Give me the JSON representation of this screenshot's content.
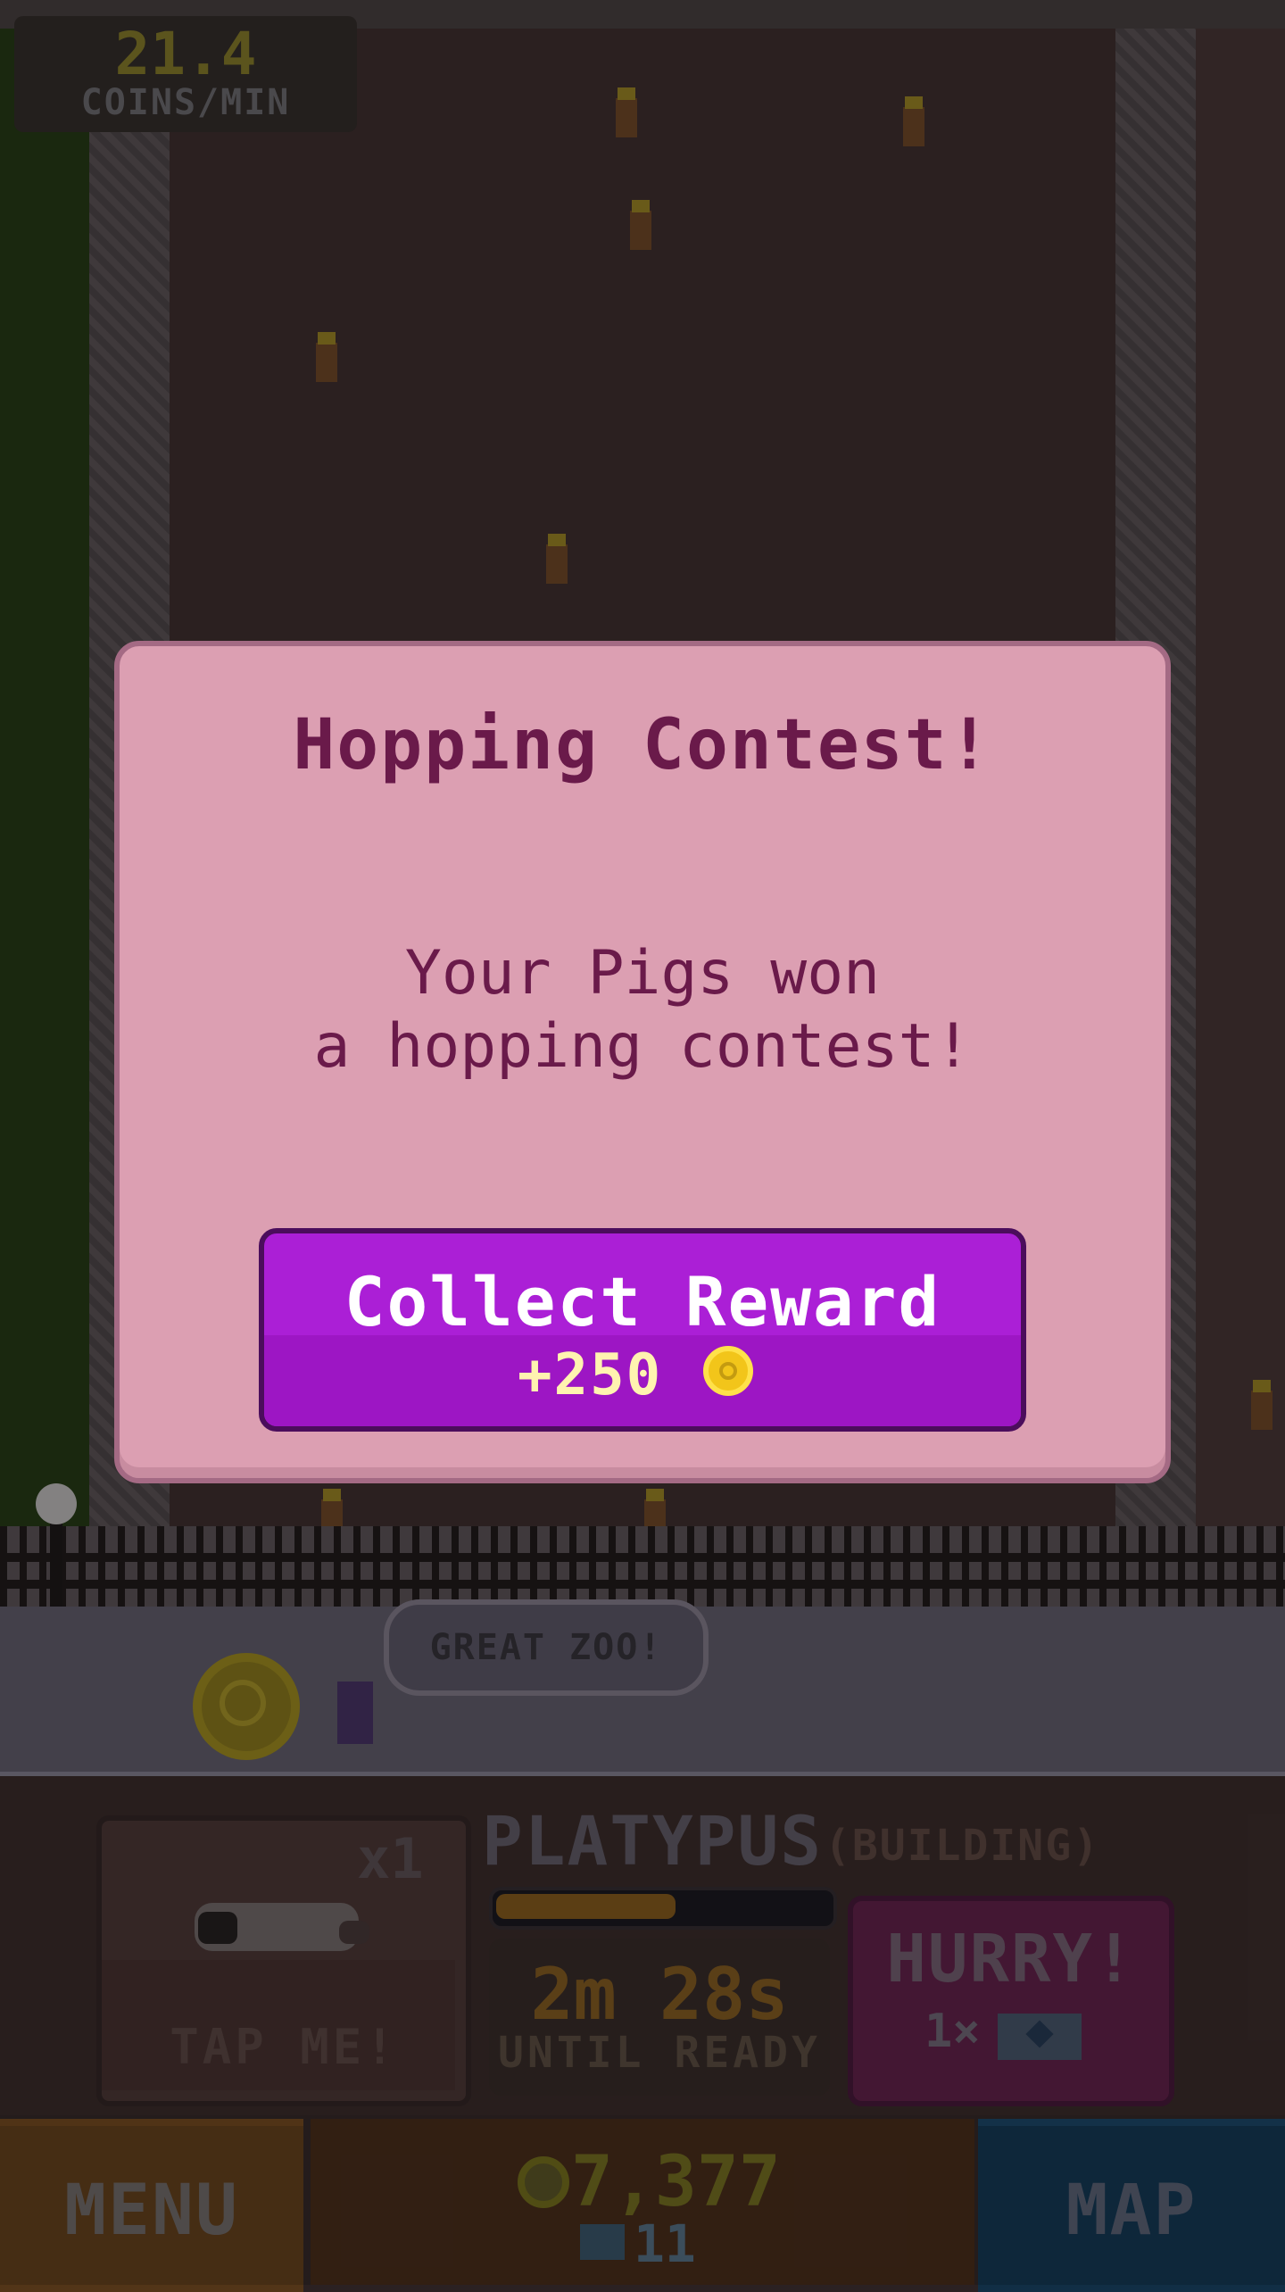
{
  "hud": {
    "coin_rate_value": "21.4",
    "coin_rate_label": "COINS/MIN"
  },
  "world": {
    "sign_text": "GREAT ZOO!"
  },
  "modal": {
    "title": "Hopping Contest!",
    "body_line1": "Your Pigs won",
    "body_line2": "a hopping contest!",
    "button_label": "Collect Reward",
    "reward_amount": "+250",
    "reward_icon": "coin-icon"
  },
  "build_panel": {
    "multiplier": "x1",
    "tap_label": "TAP ME!",
    "animal_name": "PLATYPUS",
    "status": "(BUILDING)",
    "progress": 0.55,
    "timer": "2m 28s",
    "timer_caption": "UNTIL READY",
    "hurry_label": "HURRY!",
    "hurry_cost": "1×",
    "hurry_cost_icon": "gem-icon"
  },
  "nav": {
    "menu_label": "MENU",
    "coins": "7,377",
    "gems": "11",
    "map_label": "MAP"
  },
  "colors": {
    "modal_bg": "#dc9fb2",
    "modal_text": "#6a1a4a",
    "button_bg": "#ab1fd6",
    "coin": "#f2c51a"
  }
}
